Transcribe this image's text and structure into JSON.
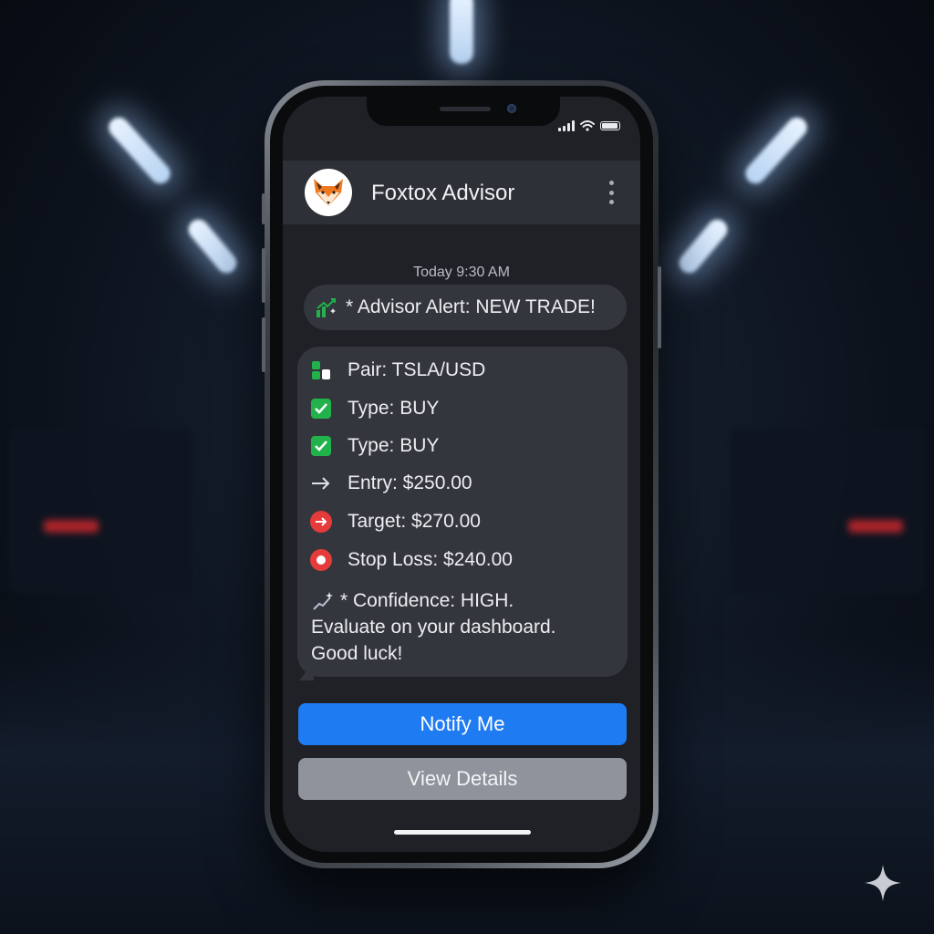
{
  "status_bar": {
    "icons": [
      "signal-icon",
      "wifi-icon",
      "battery-icon"
    ]
  },
  "header": {
    "app_name": "Foxtox Advisor",
    "avatar_icon": "fox-icon",
    "menu_icon": "more-vertical-icon"
  },
  "conversation": {
    "timestamp": "Today 9:30 AM",
    "alert": {
      "icon": "chart-up-icon",
      "text": "* Advisor Alert: NEW TRADE!"
    },
    "message": {
      "rows": [
        {
          "icon": "pair-icon",
          "text": "Pair: TSLA/USD"
        },
        {
          "icon": "check-icon",
          "text": "Type: BUY"
        },
        {
          "icon": "check-icon",
          "text": "Type: BUY"
        },
        {
          "icon": "arrow-right-icon",
          "text": "Entry: $250.00"
        },
        {
          "icon": "target-arrow-icon",
          "text": "Target: $270.00"
        },
        {
          "icon": "stop-icon",
          "text": "Stop Loss: $240.00"
        }
      ],
      "confidence_icon": "sparkle-chart-icon",
      "confidence_lines": [
        "* Confidence: HIGH.",
        "Evaluate on your dashboard.",
        "Good luck!"
      ]
    }
  },
  "actions": {
    "notify_label": "Notify Me",
    "details_label": "View Details"
  },
  "colors": {
    "primary_button": "#1f7bf2",
    "secondary_button": "#8f939b",
    "check_green": "#22b24c",
    "alert_red": "#e53b3b",
    "screen_bg": "#1f2126",
    "bubble_bg": "#33363c"
  }
}
